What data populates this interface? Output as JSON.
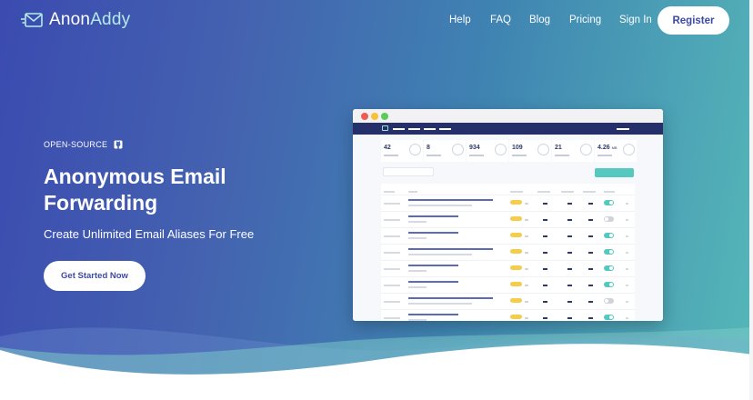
{
  "nav": {
    "logo_first": "Anon",
    "logo_second": "Addy",
    "links": [
      "Help",
      "FAQ",
      "Blog",
      "Pricing",
      "Sign In"
    ],
    "register_label": "Register"
  },
  "hero": {
    "eyebrow": "OPEN-SOURCE",
    "headline_line1": "Anonymous Email",
    "headline_line2": "Forwarding",
    "subheadline": "Create Unlimited Email Aliases For Free",
    "cta_label": "Get Started Now"
  },
  "mockup": {
    "stats": [
      "42",
      "8",
      "934",
      "109",
      "21",
      "4.26"
    ],
    "stat_unit": "MB",
    "rows": 8,
    "toggles": [
      "on",
      "off",
      "on",
      "on",
      "on",
      "on",
      "off",
      "on"
    ]
  },
  "colors": {
    "gradient_start": "#3b4bb0",
    "gradient_end": "#55b8b8",
    "accent_teal": "#55c9c0",
    "brand_dark": "#3c4aa3",
    "toggle_on": "#55c9c0",
    "toggle_off": "#cfd3da",
    "alias_pill": "#f6cc4d"
  },
  "icons": {
    "logo": "envelope-fast-icon",
    "github": "github-icon"
  }
}
